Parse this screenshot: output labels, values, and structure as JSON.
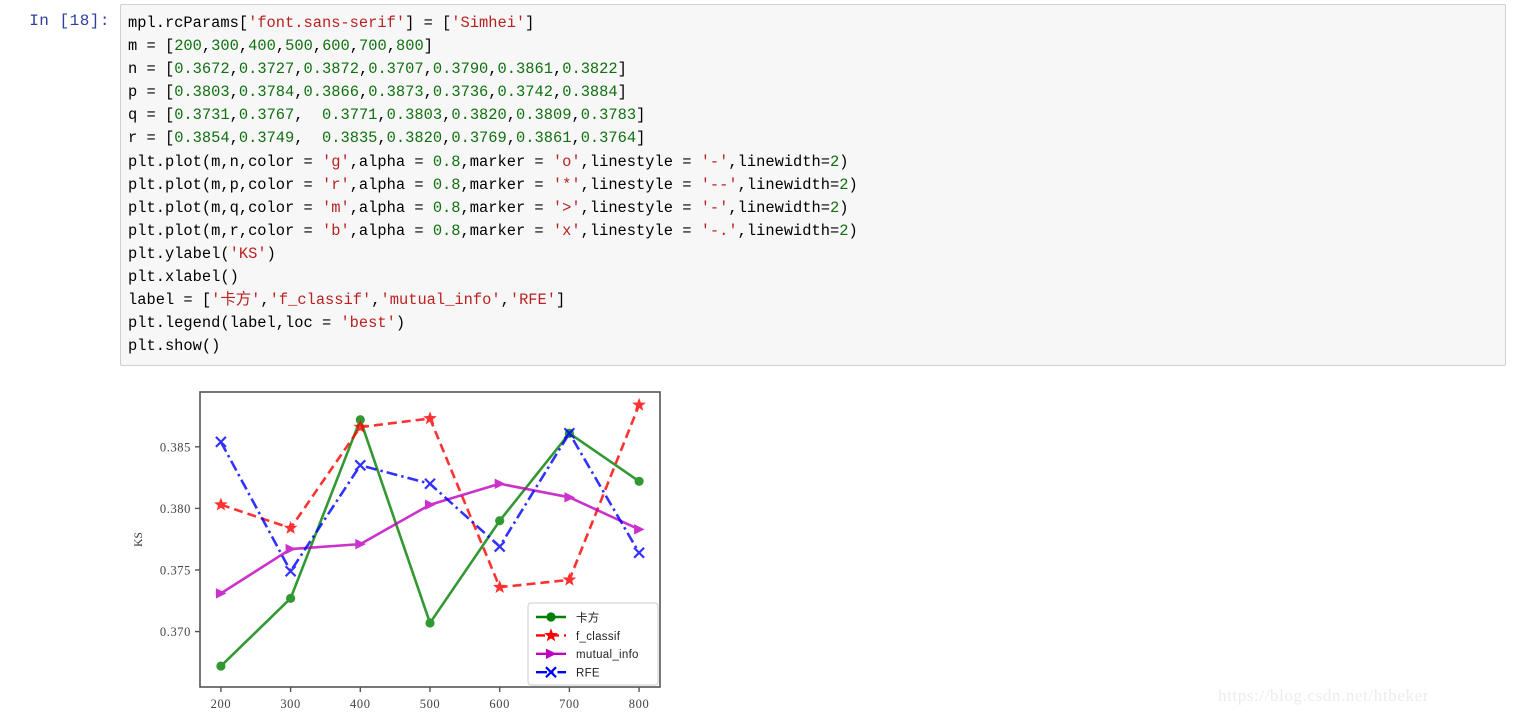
{
  "notebook": {
    "prompt_label": "In [18]:",
    "prompt_color": "#303F9F",
    "code_lines": [
      [
        {
          "t": "mpl.rcParams[",
          "c": "plain"
        },
        {
          "t": "'font.sans-serif'",
          "c": "str"
        },
        {
          "t": "] = [",
          "c": "plain"
        },
        {
          "t": "'Simhei'",
          "c": "str"
        },
        {
          "t": "]",
          "c": "plain"
        }
      ],
      [
        {
          "t": "m = [",
          "c": "plain"
        },
        {
          "t": "200",
          "c": "num"
        },
        {
          "t": ",",
          "c": "plain"
        },
        {
          "t": "300",
          "c": "num"
        },
        {
          "t": ",",
          "c": "plain"
        },
        {
          "t": "400",
          "c": "num"
        },
        {
          "t": ",",
          "c": "plain"
        },
        {
          "t": "500",
          "c": "num"
        },
        {
          "t": ",",
          "c": "plain"
        },
        {
          "t": "600",
          "c": "num"
        },
        {
          "t": ",",
          "c": "plain"
        },
        {
          "t": "700",
          "c": "num"
        },
        {
          "t": ",",
          "c": "plain"
        },
        {
          "t": "800",
          "c": "num"
        },
        {
          "t": "]",
          "c": "plain"
        }
      ],
      [
        {
          "t": "n = [",
          "c": "plain"
        },
        {
          "t": "0.3672",
          "c": "num"
        },
        {
          "t": ",",
          "c": "plain"
        },
        {
          "t": "0.3727",
          "c": "num"
        },
        {
          "t": ",",
          "c": "plain"
        },
        {
          "t": "0.3872",
          "c": "num"
        },
        {
          "t": ",",
          "c": "plain"
        },
        {
          "t": "0.3707",
          "c": "num"
        },
        {
          "t": ",",
          "c": "plain"
        },
        {
          "t": "0.3790",
          "c": "num"
        },
        {
          "t": ",",
          "c": "plain"
        },
        {
          "t": "0.3861",
          "c": "num"
        },
        {
          "t": ",",
          "c": "plain"
        },
        {
          "t": "0.3822",
          "c": "num"
        },
        {
          "t": "]",
          "c": "plain"
        }
      ],
      [
        {
          "t": "p = [",
          "c": "plain"
        },
        {
          "t": "0.3803",
          "c": "num"
        },
        {
          "t": ",",
          "c": "plain"
        },
        {
          "t": "0.3784",
          "c": "num"
        },
        {
          "t": ",",
          "c": "plain"
        },
        {
          "t": "0.3866",
          "c": "num"
        },
        {
          "t": ",",
          "c": "plain"
        },
        {
          "t": "0.3873",
          "c": "num"
        },
        {
          "t": ",",
          "c": "plain"
        },
        {
          "t": "0.3736",
          "c": "num"
        },
        {
          "t": ",",
          "c": "plain"
        },
        {
          "t": "0.3742",
          "c": "num"
        },
        {
          "t": ",",
          "c": "plain"
        },
        {
          "t": "0.3884",
          "c": "num"
        },
        {
          "t": "]",
          "c": "plain"
        }
      ],
      [
        {
          "t": "q = [",
          "c": "plain"
        },
        {
          "t": "0.3731",
          "c": "num"
        },
        {
          "t": ",",
          "c": "plain"
        },
        {
          "t": "0.3767",
          "c": "num"
        },
        {
          "t": ",  ",
          "c": "plain"
        },
        {
          "t": "0.3771",
          "c": "num"
        },
        {
          "t": ",",
          "c": "plain"
        },
        {
          "t": "0.3803",
          "c": "num"
        },
        {
          "t": ",",
          "c": "plain"
        },
        {
          "t": "0.3820",
          "c": "num"
        },
        {
          "t": ",",
          "c": "plain"
        },
        {
          "t": "0.3809",
          "c": "num"
        },
        {
          "t": ",",
          "c": "plain"
        },
        {
          "t": "0.3783",
          "c": "num"
        },
        {
          "t": "]",
          "c": "plain"
        }
      ],
      [
        {
          "t": "r = [",
          "c": "plain"
        },
        {
          "t": "0.3854",
          "c": "num"
        },
        {
          "t": ",",
          "c": "plain"
        },
        {
          "t": "0.3749",
          "c": "num"
        },
        {
          "t": ",  ",
          "c": "plain"
        },
        {
          "t": "0.3835",
          "c": "num"
        },
        {
          "t": ",",
          "c": "plain"
        },
        {
          "t": "0.3820",
          "c": "num"
        },
        {
          "t": ",",
          "c": "plain"
        },
        {
          "t": "0.3769",
          "c": "num"
        },
        {
          "t": ",",
          "c": "plain"
        },
        {
          "t": "0.3861",
          "c": "num"
        },
        {
          "t": ",",
          "c": "plain"
        },
        {
          "t": "0.3764",
          "c": "num"
        },
        {
          "t": "]",
          "c": "plain"
        }
      ],
      [
        {
          "t": "plt.plot(m,n,color = ",
          "c": "plain"
        },
        {
          "t": "'g'",
          "c": "str"
        },
        {
          "t": ",alpha = ",
          "c": "plain"
        },
        {
          "t": "0.8",
          "c": "num"
        },
        {
          "t": ",marker = ",
          "c": "plain"
        },
        {
          "t": "'o'",
          "c": "str"
        },
        {
          "t": ",linestyle = ",
          "c": "plain"
        },
        {
          "t": "'-'",
          "c": "str"
        },
        {
          "t": ",linewidth=",
          "c": "plain"
        },
        {
          "t": "2",
          "c": "num"
        },
        {
          "t": ")",
          "c": "plain"
        }
      ],
      [
        {
          "t": "plt.plot(m,p,color = ",
          "c": "plain"
        },
        {
          "t": "'r'",
          "c": "str"
        },
        {
          "t": ",alpha = ",
          "c": "plain"
        },
        {
          "t": "0.8",
          "c": "num"
        },
        {
          "t": ",marker = ",
          "c": "plain"
        },
        {
          "t": "'*'",
          "c": "str"
        },
        {
          "t": ",linestyle = ",
          "c": "plain"
        },
        {
          "t": "'--'",
          "c": "str"
        },
        {
          "t": ",linewidth=",
          "c": "plain"
        },
        {
          "t": "2",
          "c": "num"
        },
        {
          "t": ")",
          "c": "plain"
        }
      ],
      [
        {
          "t": "plt.plot(m,q,color = ",
          "c": "plain"
        },
        {
          "t": "'m'",
          "c": "str"
        },
        {
          "t": ",alpha = ",
          "c": "plain"
        },
        {
          "t": "0.8",
          "c": "num"
        },
        {
          "t": ",marker = ",
          "c": "plain"
        },
        {
          "t": "'>'",
          "c": "str"
        },
        {
          "t": ",linestyle = ",
          "c": "plain"
        },
        {
          "t": "'-'",
          "c": "str"
        },
        {
          "t": ",linewidth=",
          "c": "plain"
        },
        {
          "t": "2",
          "c": "num"
        },
        {
          "t": ")",
          "c": "plain"
        }
      ],
      [
        {
          "t": "plt.plot(m,r,color = ",
          "c": "plain"
        },
        {
          "t": "'b'",
          "c": "str"
        },
        {
          "t": ",alpha = ",
          "c": "plain"
        },
        {
          "t": "0.8",
          "c": "num"
        },
        {
          "t": ",marker = ",
          "c": "plain"
        },
        {
          "t": "'x'",
          "c": "str"
        },
        {
          "t": ",linestyle = ",
          "c": "plain"
        },
        {
          "t": "'-.'",
          "c": "str"
        },
        {
          "t": ",linewidth=",
          "c": "plain"
        },
        {
          "t": "2",
          "c": "num"
        },
        {
          "t": ")",
          "c": "plain"
        }
      ],
      [
        {
          "t": "plt.ylabel(",
          "c": "plain"
        },
        {
          "t": "'KS'",
          "c": "str"
        },
        {
          "t": ")",
          "c": "plain"
        }
      ],
      [
        {
          "t": "plt.xlabel()",
          "c": "plain"
        }
      ],
      [
        {
          "t": "label = [",
          "c": "plain"
        },
        {
          "t": "'卡方'",
          "c": "str"
        },
        {
          "t": ",",
          "c": "plain"
        },
        {
          "t": "'f_classif'",
          "c": "str"
        },
        {
          "t": ",",
          "c": "plain"
        },
        {
          "t": "'mutual_info'",
          "c": "str"
        },
        {
          "t": ",",
          "c": "plain"
        },
        {
          "t": "'RFE'",
          "c": "str"
        },
        {
          "t": "]",
          "c": "plain"
        }
      ],
      [
        {
          "t": "plt.legend(label,loc = ",
          "c": "plain"
        },
        {
          "t": "'best'",
          "c": "str"
        },
        {
          "t": ")",
          "c": "plain"
        }
      ],
      [
        {
          "t": "plt.show()",
          "c": "plain"
        }
      ]
    ]
  },
  "chart_data": {
    "type": "line",
    "title": "",
    "xlabel": "",
    "ylabel": "KS",
    "x": [
      200,
      300,
      400,
      500,
      600,
      700,
      800
    ],
    "xticks": [
      "200",
      "300",
      "400",
      "500",
      "600",
      "700",
      "800"
    ],
    "yticks": [
      "0.370",
      "0.375",
      "0.380",
      "0.385"
    ],
    "ytick_values": [
      0.37,
      0.375,
      0.38,
      0.385
    ],
    "xlim": [
      170,
      830
    ],
    "ylim": [
      0.3655,
      0.38945
    ],
    "grid": false,
    "legend_position": "lower right",
    "series": [
      {
        "name": "卡方",
        "color": "#008000",
        "marker": "o",
        "linestyle": "-",
        "linewidth": 2,
        "alpha": 0.8,
        "values": [
          0.3672,
          0.3727,
          0.3872,
          0.3707,
          0.379,
          0.3861,
          0.3822
        ]
      },
      {
        "name": "f_classif",
        "color": "#FF0000",
        "marker": "*",
        "linestyle": "--",
        "linewidth": 2,
        "alpha": 0.8,
        "values": [
          0.3803,
          0.3784,
          0.3866,
          0.3873,
          0.3736,
          0.3742,
          0.3884
        ]
      },
      {
        "name": "mutual_info",
        "color": "#BF00BF",
        "marker": ">",
        "linestyle": "-",
        "linewidth": 2,
        "alpha": 0.8,
        "values": [
          0.3731,
          0.3767,
          0.3771,
          0.3803,
          0.382,
          0.3809,
          0.3783
        ]
      },
      {
        "name": "RFE",
        "color": "#0000FF",
        "marker": "x",
        "linestyle": "-.",
        "linewidth": 2,
        "alpha": 0.8,
        "values": [
          0.3854,
          0.3749,
          0.3835,
          0.382,
          0.3769,
          0.3861,
          0.3764
        ]
      }
    ]
  },
  "watermark": {
    "text": "https://blog.csdn.net/htbeker"
  }
}
